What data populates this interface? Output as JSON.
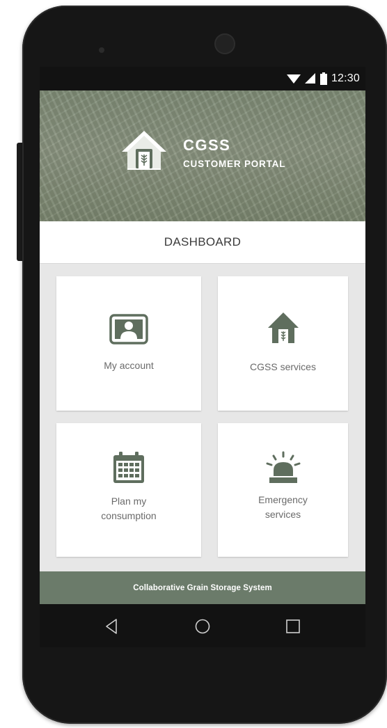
{
  "status_bar": {
    "time": "12:30"
  },
  "header": {
    "title": "CGSS",
    "subtitle": "CUSTOMER PORTAL"
  },
  "dashboard": {
    "title": "DASHBOARD",
    "tiles": [
      {
        "label": "My account",
        "icon": "account-icon"
      },
      {
        "label": "CGSS services",
        "icon": "grain-house-icon"
      },
      {
        "label_line1": "Plan my",
        "label_line2": "consumption",
        "icon": "calendar-icon"
      },
      {
        "label_line1": "Emergency",
        "label_line2": "services",
        "icon": "emergency-siren-icon"
      }
    ]
  },
  "footer": {
    "text": "Collaborative Grain Storage System"
  },
  "nav": {
    "back": "back-icon",
    "home": "home-icon",
    "recents": "recents-icon"
  },
  "colors": {
    "accent": "#6b7b6a",
    "icon": "#5f6e5e",
    "hero": "#84907a"
  }
}
